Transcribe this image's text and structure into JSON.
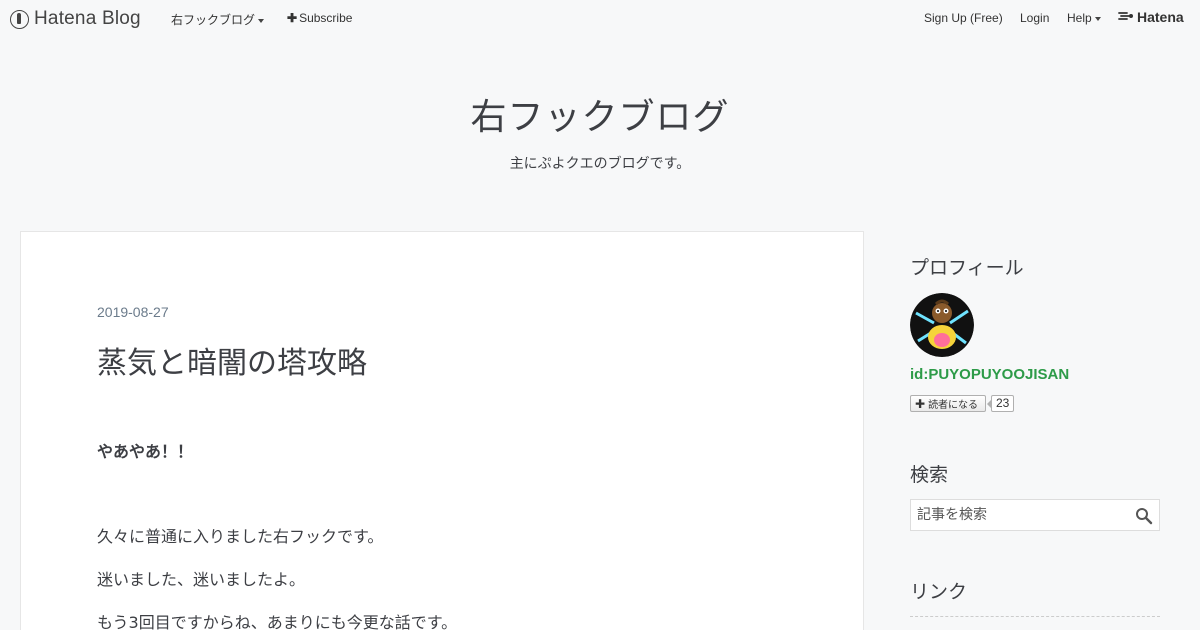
{
  "topbar": {
    "brand": "Hatena Blog",
    "blog_menu": "右フックブログ",
    "subscribe": "Subscribe",
    "signup": "Sign Up (Free)",
    "login": "Login",
    "help": "Help",
    "hatena": "Hatena"
  },
  "header": {
    "title": "右フックブログ",
    "description": "主にぷよクエのブログです。"
  },
  "article": {
    "date": "2019-08-27",
    "title": "蒸気と暗闇の塔攻略",
    "paragraphs": [
      "やあやあ！！",
      "久々に普通に入りました右フックです。",
      "迷いました、迷いましたよ。",
      "もう3回目ですからね、あまりにも今更な話です。"
    ]
  },
  "sidebar": {
    "profile_heading": "プロフィール",
    "profile_id": "id:PUYOPUYOOJISAN",
    "subscribe_label": "読者になる",
    "subscriber_count": "23",
    "search_heading": "検索",
    "search_placeholder": "記事を検索",
    "links_heading": "リンク"
  },
  "colors": {
    "background": "#f7f8f9",
    "content": "#ffffff",
    "text": "#3d3f44",
    "date": "#6b7b8b",
    "profile_link": "#2d9b48"
  }
}
